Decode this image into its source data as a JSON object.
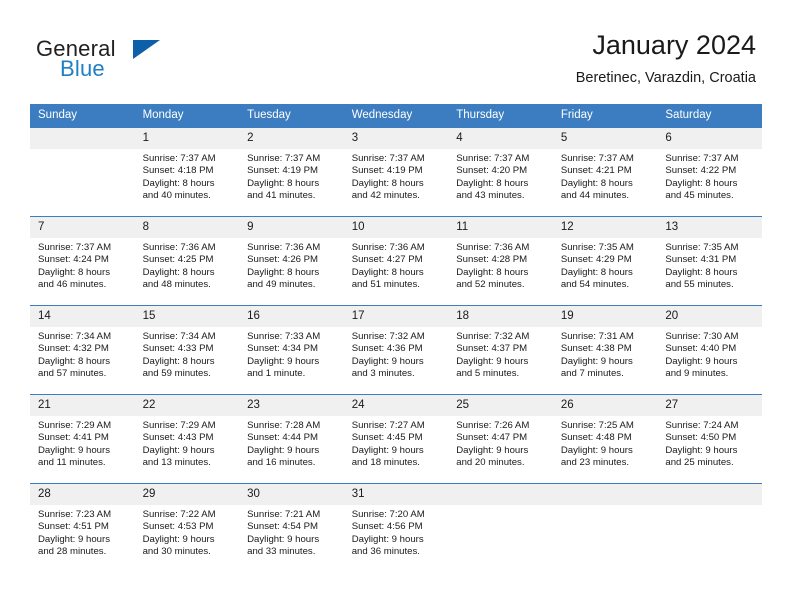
{
  "brand": {
    "name_part1": "General",
    "name_part2": "Blue",
    "triangle_color": "#0d5fa8",
    "blue_color": "#1e7fc6"
  },
  "header": {
    "title": "January 2024",
    "subtitle": "Beretinec, Varazdin, Croatia"
  },
  "theme": {
    "header_bg": "#3b7dc0",
    "daynum_bg": "#f0f0f0",
    "text": "#1a1a1a"
  },
  "calendar": {
    "weekday_headers": [
      "Sunday",
      "Monday",
      "Tuesday",
      "Wednesday",
      "Thursday",
      "Friday",
      "Saturday"
    ],
    "weeks": [
      [
        {
          "day": "",
          "empty": true,
          "sunrise": "",
          "sunset": "",
          "daylight_line1": "",
          "daylight_line2": ""
        },
        {
          "day": "1",
          "empty": false,
          "sunrise": "Sunrise: 7:37 AM",
          "sunset": "Sunset: 4:18 PM",
          "daylight_line1": "Daylight: 8 hours",
          "daylight_line2": "and 40 minutes."
        },
        {
          "day": "2",
          "empty": false,
          "sunrise": "Sunrise: 7:37 AM",
          "sunset": "Sunset: 4:19 PM",
          "daylight_line1": "Daylight: 8 hours",
          "daylight_line2": "and 41 minutes."
        },
        {
          "day": "3",
          "empty": false,
          "sunrise": "Sunrise: 7:37 AM",
          "sunset": "Sunset: 4:19 PM",
          "daylight_line1": "Daylight: 8 hours",
          "daylight_line2": "and 42 minutes."
        },
        {
          "day": "4",
          "empty": false,
          "sunrise": "Sunrise: 7:37 AM",
          "sunset": "Sunset: 4:20 PM",
          "daylight_line1": "Daylight: 8 hours",
          "daylight_line2": "and 43 minutes."
        },
        {
          "day": "5",
          "empty": false,
          "sunrise": "Sunrise: 7:37 AM",
          "sunset": "Sunset: 4:21 PM",
          "daylight_line1": "Daylight: 8 hours",
          "daylight_line2": "and 44 minutes."
        },
        {
          "day": "6",
          "empty": false,
          "sunrise": "Sunrise: 7:37 AM",
          "sunset": "Sunset: 4:22 PM",
          "daylight_line1": "Daylight: 8 hours",
          "daylight_line2": "and 45 minutes."
        }
      ],
      [
        {
          "day": "7",
          "empty": false,
          "sunrise": "Sunrise: 7:37 AM",
          "sunset": "Sunset: 4:24 PM",
          "daylight_line1": "Daylight: 8 hours",
          "daylight_line2": "and 46 minutes."
        },
        {
          "day": "8",
          "empty": false,
          "sunrise": "Sunrise: 7:36 AM",
          "sunset": "Sunset: 4:25 PM",
          "daylight_line1": "Daylight: 8 hours",
          "daylight_line2": "and 48 minutes."
        },
        {
          "day": "9",
          "empty": false,
          "sunrise": "Sunrise: 7:36 AM",
          "sunset": "Sunset: 4:26 PM",
          "daylight_line1": "Daylight: 8 hours",
          "daylight_line2": "and 49 minutes."
        },
        {
          "day": "10",
          "empty": false,
          "sunrise": "Sunrise: 7:36 AM",
          "sunset": "Sunset: 4:27 PM",
          "daylight_line1": "Daylight: 8 hours",
          "daylight_line2": "and 51 minutes."
        },
        {
          "day": "11",
          "empty": false,
          "sunrise": "Sunrise: 7:36 AM",
          "sunset": "Sunset: 4:28 PM",
          "daylight_line1": "Daylight: 8 hours",
          "daylight_line2": "and 52 minutes."
        },
        {
          "day": "12",
          "empty": false,
          "sunrise": "Sunrise: 7:35 AM",
          "sunset": "Sunset: 4:29 PM",
          "daylight_line1": "Daylight: 8 hours",
          "daylight_line2": "and 54 minutes."
        },
        {
          "day": "13",
          "empty": false,
          "sunrise": "Sunrise: 7:35 AM",
          "sunset": "Sunset: 4:31 PM",
          "daylight_line1": "Daylight: 8 hours",
          "daylight_line2": "and 55 minutes."
        }
      ],
      [
        {
          "day": "14",
          "empty": false,
          "sunrise": "Sunrise: 7:34 AM",
          "sunset": "Sunset: 4:32 PM",
          "daylight_line1": "Daylight: 8 hours",
          "daylight_line2": "and 57 minutes."
        },
        {
          "day": "15",
          "empty": false,
          "sunrise": "Sunrise: 7:34 AM",
          "sunset": "Sunset: 4:33 PM",
          "daylight_line1": "Daylight: 8 hours",
          "daylight_line2": "and 59 minutes."
        },
        {
          "day": "16",
          "empty": false,
          "sunrise": "Sunrise: 7:33 AM",
          "sunset": "Sunset: 4:34 PM",
          "daylight_line1": "Daylight: 9 hours",
          "daylight_line2": "and 1 minute."
        },
        {
          "day": "17",
          "empty": false,
          "sunrise": "Sunrise: 7:32 AM",
          "sunset": "Sunset: 4:36 PM",
          "daylight_line1": "Daylight: 9 hours",
          "daylight_line2": "and 3 minutes."
        },
        {
          "day": "18",
          "empty": false,
          "sunrise": "Sunrise: 7:32 AM",
          "sunset": "Sunset: 4:37 PM",
          "daylight_line1": "Daylight: 9 hours",
          "daylight_line2": "and 5 minutes."
        },
        {
          "day": "19",
          "empty": false,
          "sunrise": "Sunrise: 7:31 AM",
          "sunset": "Sunset: 4:38 PM",
          "daylight_line1": "Daylight: 9 hours",
          "daylight_line2": "and 7 minutes."
        },
        {
          "day": "20",
          "empty": false,
          "sunrise": "Sunrise: 7:30 AM",
          "sunset": "Sunset: 4:40 PM",
          "daylight_line1": "Daylight: 9 hours",
          "daylight_line2": "and 9 minutes."
        }
      ],
      [
        {
          "day": "21",
          "empty": false,
          "sunrise": "Sunrise: 7:29 AM",
          "sunset": "Sunset: 4:41 PM",
          "daylight_line1": "Daylight: 9 hours",
          "daylight_line2": "and 11 minutes."
        },
        {
          "day": "22",
          "empty": false,
          "sunrise": "Sunrise: 7:29 AM",
          "sunset": "Sunset: 4:43 PM",
          "daylight_line1": "Daylight: 9 hours",
          "daylight_line2": "and 13 minutes."
        },
        {
          "day": "23",
          "empty": false,
          "sunrise": "Sunrise: 7:28 AM",
          "sunset": "Sunset: 4:44 PM",
          "daylight_line1": "Daylight: 9 hours",
          "daylight_line2": "and 16 minutes."
        },
        {
          "day": "24",
          "empty": false,
          "sunrise": "Sunrise: 7:27 AM",
          "sunset": "Sunset: 4:45 PM",
          "daylight_line1": "Daylight: 9 hours",
          "daylight_line2": "and 18 minutes."
        },
        {
          "day": "25",
          "empty": false,
          "sunrise": "Sunrise: 7:26 AM",
          "sunset": "Sunset: 4:47 PM",
          "daylight_line1": "Daylight: 9 hours",
          "daylight_line2": "and 20 minutes."
        },
        {
          "day": "26",
          "empty": false,
          "sunrise": "Sunrise: 7:25 AM",
          "sunset": "Sunset: 4:48 PM",
          "daylight_line1": "Daylight: 9 hours",
          "daylight_line2": "and 23 minutes."
        },
        {
          "day": "27",
          "empty": false,
          "sunrise": "Sunrise: 7:24 AM",
          "sunset": "Sunset: 4:50 PM",
          "daylight_line1": "Daylight: 9 hours",
          "daylight_line2": "and 25 minutes."
        }
      ],
      [
        {
          "day": "28",
          "empty": false,
          "sunrise": "Sunrise: 7:23 AM",
          "sunset": "Sunset: 4:51 PM",
          "daylight_line1": "Daylight: 9 hours",
          "daylight_line2": "and 28 minutes."
        },
        {
          "day": "29",
          "empty": false,
          "sunrise": "Sunrise: 7:22 AM",
          "sunset": "Sunset: 4:53 PM",
          "daylight_line1": "Daylight: 9 hours",
          "daylight_line2": "and 30 minutes."
        },
        {
          "day": "30",
          "empty": false,
          "sunrise": "Sunrise: 7:21 AM",
          "sunset": "Sunset: 4:54 PM",
          "daylight_line1": "Daylight: 9 hours",
          "daylight_line2": "and 33 minutes."
        },
        {
          "day": "31",
          "empty": false,
          "sunrise": "Sunrise: 7:20 AM",
          "sunset": "Sunset: 4:56 PM",
          "daylight_line1": "Daylight: 9 hours",
          "daylight_line2": "and 36 minutes."
        },
        {
          "day": "",
          "empty": true,
          "sunrise": "",
          "sunset": "",
          "daylight_line1": "",
          "daylight_line2": ""
        },
        {
          "day": "",
          "empty": true,
          "sunrise": "",
          "sunset": "",
          "daylight_line1": "",
          "daylight_line2": ""
        },
        {
          "day": "",
          "empty": true,
          "sunrise": "",
          "sunset": "",
          "daylight_line1": "",
          "daylight_line2": ""
        }
      ]
    ]
  }
}
